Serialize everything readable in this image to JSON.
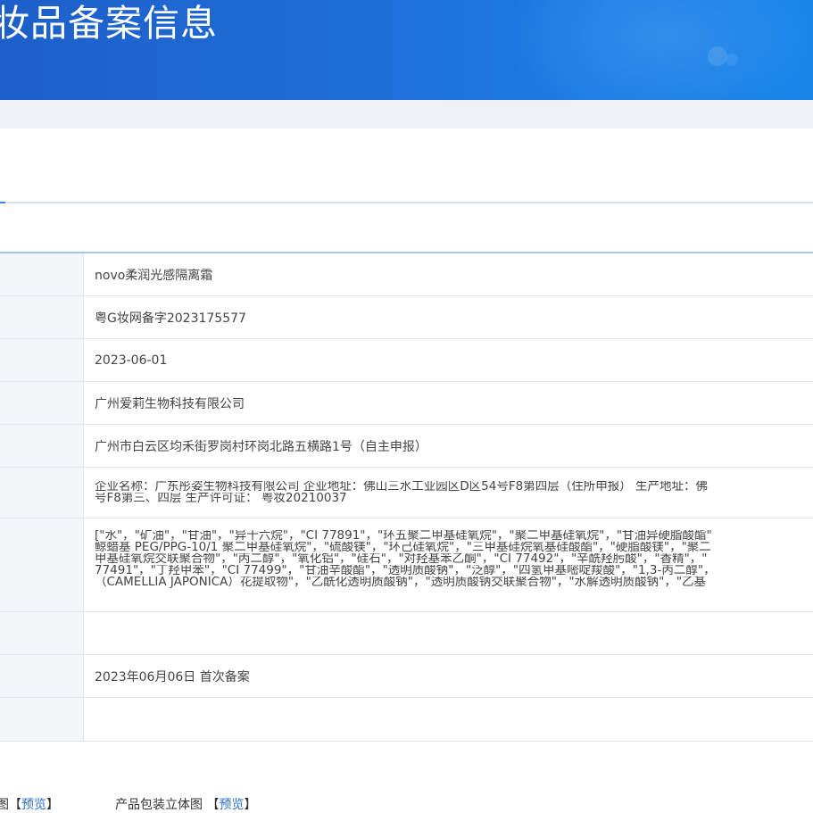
{
  "header": {
    "title": "妆品备案信息"
  },
  "details": {
    "product_name": "novo柔润光感隔离霜",
    "record_number": "粤G妆网备字2023175577",
    "record_date": "2023-06-01",
    "registrant": "广州爱莉生物科技有限公司",
    "registrant_address": "广州市白云区均禾街罗岗村环岗北路五横路1号（自主申报）",
    "manufacturer_lines": [
      "企业名称：广东彤姿生物科技有限公司 企业地址：佛山三水工业园区D区54号F8第四层（住所申报） 生产地址：佛",
      "号F8第三、四层 生产许可证： 粤妆20210037"
    ],
    "ingredients_lines": [
      "[\"水\"，\"矿油\"，\"甘油\"，\"异十六烷\"，\"CI 77891\"，\"环五聚二甲基硅氧烷\"，\"聚二甲基硅氧烷\"，\"甘油异硬脂酸酯\"",
      "鲸蜡基 PEG/PPG-10/1 聚二甲基硅氧烷\"，\"硫酸镁\"，\"环己硅氧烷\"，\"三甲基硅烷氧基硅酸酯\"，\"硬脂酸镁\"，\"聚二",
      "甲基硅氧烷交联聚合物\"，\"丙二醇\"，\"氧化铝\"，\"硅石\"，\"对羟基苯乙酮\"，\"CI 77492\"，\"辛酰羟肟酸\"，\"香精\"，\"",
      "77491\"，\"丁羟甲苯\"，\"CI 77499\"，\"甘油辛酸酯\"，\"透明质酸钠\"，\"泛醇\"，\"四氢甲基嘧啶羧酸\"，\"1,3-丙二醇\"，",
      "（CAMELLIA JAPONICA）花提取物\"，\"乙酰化透明质酸钠\"，\"透明质酸钠交联聚合物\"，\"水解透明质酸钠\"，\"乙基"
    ],
    "blank_row_1": "",
    "record_status": "2023年06月06日 首次备案",
    "blank_row_2": ""
  },
  "footer": {
    "item1_label": "图",
    "item2_label": "产品包装立体图",
    "bracket_open": "【",
    "bracket_close": "】",
    "preview_link": "预览"
  },
  "colors": {
    "banner_blue": "#1f6ed8",
    "link_blue": "#2a6fd6"
  }
}
